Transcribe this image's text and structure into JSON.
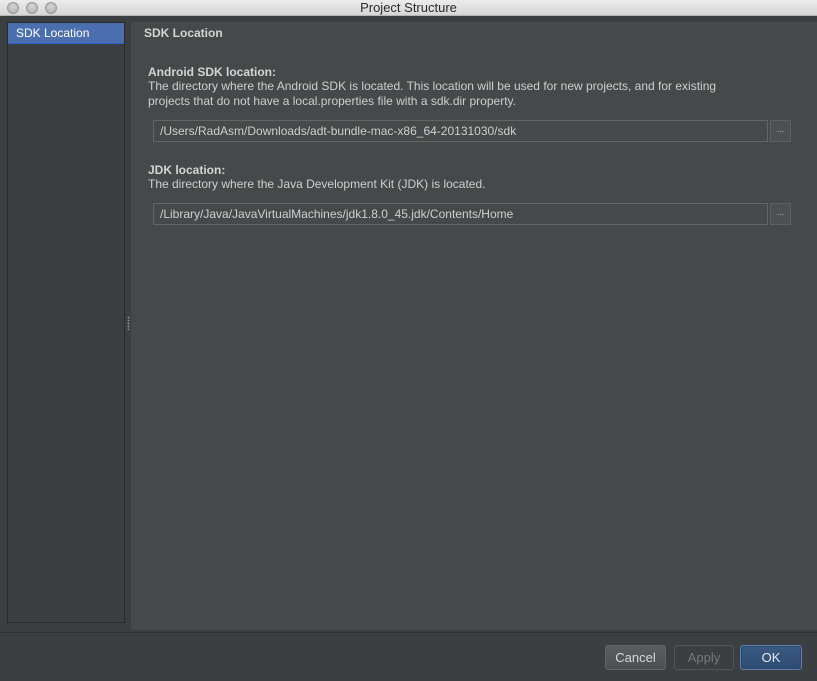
{
  "window": {
    "title": "Project Structure"
  },
  "sidebar": {
    "items": [
      {
        "label": "SDK Location",
        "selected": true
      }
    ]
  },
  "main": {
    "section_title": "SDK Location",
    "android_sdk": {
      "title": "Android SDK location:",
      "description_line1": "The directory where the Android SDK is located. This location will be used for new projects, and for existing",
      "description_line2": "projects that do not have a local.properties file with a sdk.dir property.",
      "path": "/Users/RadAsm/Downloads/adt-bundle-mac-x86_64-20131030/sdk",
      "browse_label": "..."
    },
    "jdk": {
      "title": "JDK location:",
      "description": "The directory where the Java Development Kit (JDK) is located.",
      "path": "/Library/Java/JavaVirtualMachines/jdk1.8.0_45.jdk/Contents/Home",
      "browse_label": "..."
    }
  },
  "footer": {
    "cancel_label": "Cancel",
    "apply_label": "Apply",
    "ok_label": "OK"
  },
  "colors": {
    "background": "#3c3f41",
    "selection": "#4b6eaf",
    "default_button": "#2d4a70"
  }
}
